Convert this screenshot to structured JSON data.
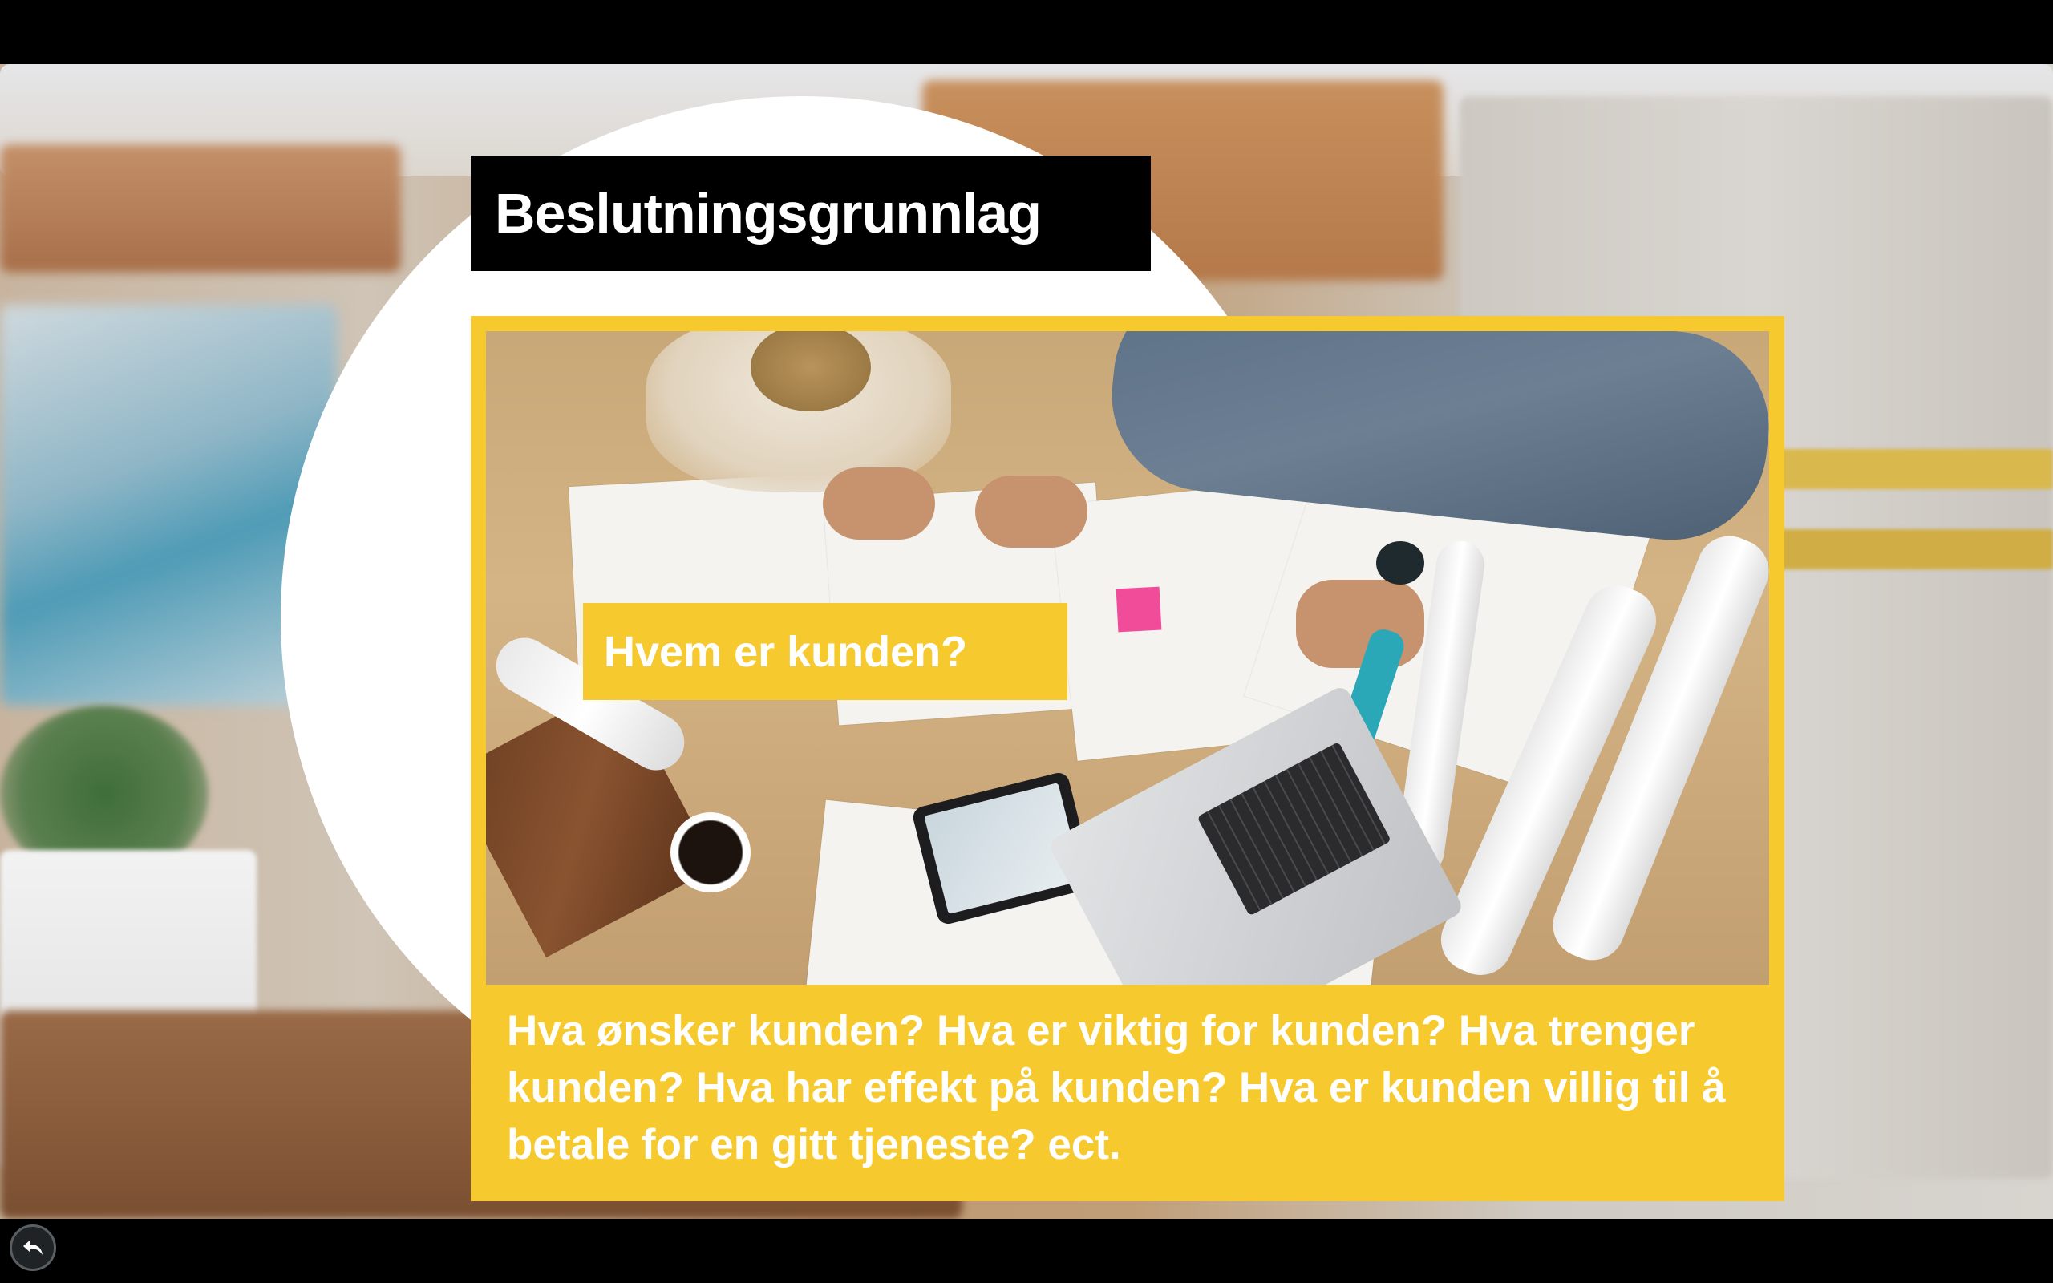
{
  "slide": {
    "title": "Beslutningsgrunnlag",
    "question": "Hvem er kunden?",
    "caption": "Hva ønsker kunden? Hva er viktig for kunden? Hva trenger kunden? Hva har effekt på kunden? Hva er kunden villig til å betale for en gitt tjeneste? ect."
  },
  "controls": {
    "back_icon": "back-arrow-icon"
  },
  "colors": {
    "accent_yellow": "#f6c92f",
    "title_background": "#000000",
    "text_white": "#ffffff",
    "sticky_note": "#f04c9a"
  }
}
